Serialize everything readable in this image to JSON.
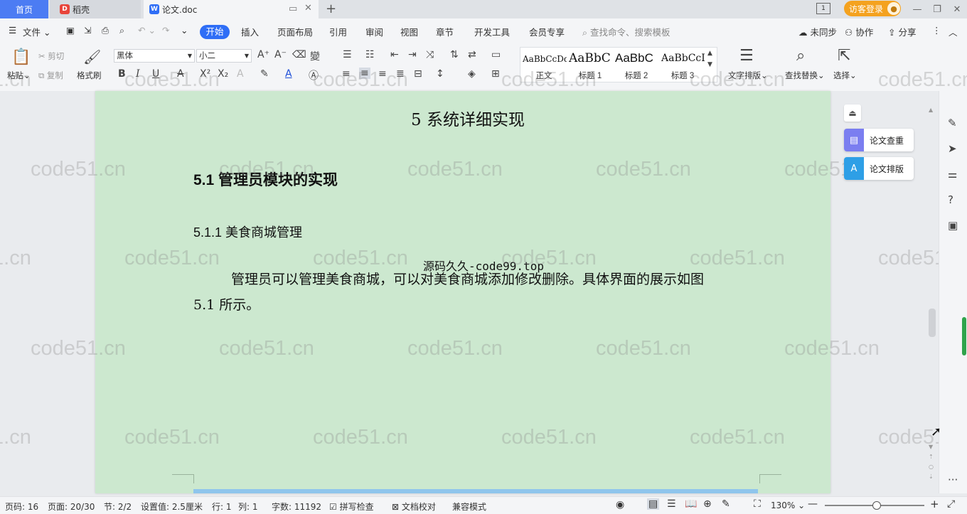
{
  "tabs": {
    "home": "首页",
    "daoke": "稻壳",
    "doc": "论文.doc"
  },
  "titlebar": {
    "login": "访客登录",
    "page_num": "1"
  },
  "menu": {
    "file": "文件",
    "items": [
      "开始",
      "插入",
      "页面布局",
      "引用",
      "审阅",
      "视图",
      "章节",
      "开发工具",
      "会员专享"
    ],
    "search_placeholder": "查找命令、搜索模板",
    "sync": "未同步",
    "collab": "协作",
    "share": "分享"
  },
  "ribbon": {
    "paste": "粘贴",
    "cut": "剪切",
    "copy": "复制",
    "format_painter": "格式刷",
    "font_name": "黑体",
    "font_size": "小二",
    "styles": [
      {
        "sample": "AaBbCcDd",
        "name": "正文"
      },
      {
        "sample": "AaBbC",
        "name": "标题 1"
      },
      {
        "sample": "AaBbC",
        "name": "标题 2"
      },
      {
        "sample": "AaBbCcI",
        "name": "标题 3"
      }
    ],
    "text_layout": "文字排版",
    "find_replace": "查找替换",
    "select": "选择"
  },
  "document": {
    "chapter_title": "5 系统详细实现",
    "section_title": "5.1  管理员模块的实现",
    "subsection_title": "5.1.1  美食商城管理",
    "source_note": "源码久久-code99.top",
    "para_line1": "管理员可以管理美食商城，可以对美食商城添加修改删除。具体界面的展示如图",
    "para_line2": "5.1 所示。"
  },
  "float_buttons": {
    "check": "论文查重",
    "layout": "论文排版"
  },
  "watermark": "code51.cn",
  "status": {
    "page_code": "页码: 16",
    "page": "页面: 20/30",
    "section": "节: 2/2",
    "setting": "设置值: 2.5厘米",
    "row": "行: 1",
    "col": "列: 1",
    "words": "字数: 11192",
    "spell": "拼写检查",
    "proof": "文档校对",
    "compat": "兼容模式",
    "zoom": "130%"
  }
}
